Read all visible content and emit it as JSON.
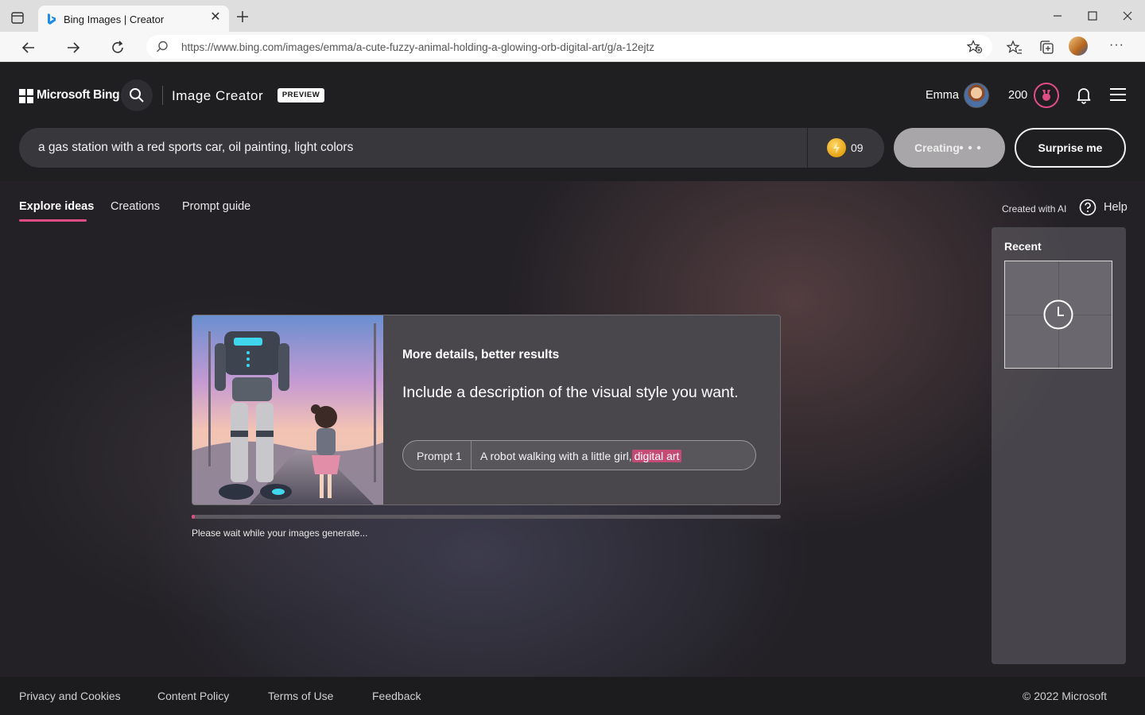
{
  "browser": {
    "tab_title": "Bing Images | Creator",
    "tab_close": "✕",
    "url": "https://www.bing.com/images/emma/a-cute-fuzzy-animal-holding-a-glowing-orb-digital-art/g/a-12ejtz",
    "more_label": "···"
  },
  "header": {
    "brand": "Microsoft Bing",
    "product": "Image Creator",
    "badge": "PREVIEW",
    "user_name": "Emma",
    "points": "200"
  },
  "prompt": {
    "value": "a gas station with a red sports car, oil painting, light colors",
    "boosts": "09"
  },
  "buttons": {
    "creating": "Creating",
    "surprise": "Surprise me"
  },
  "tabs": [
    {
      "label": "Explore ideas",
      "active": true
    },
    {
      "label": "Creations",
      "active": false
    },
    {
      "label": "Prompt guide",
      "active": false
    }
  ],
  "right_header": {
    "created_with_ai": "Created with AI",
    "help": "Help"
  },
  "recent": {
    "title": "Recent"
  },
  "tip": {
    "heading": "More details, better results",
    "body": "Include a description of the visual style you want.",
    "prompt_label": "Prompt 1",
    "prompt_text": "A robot walking with a little girl,",
    "prompt_highlight": "digital art"
  },
  "progress": {
    "fraction": 0.005,
    "message": "Please wait while your images generate..."
  },
  "footer": {
    "links": [
      "Privacy and Cookies",
      "Content Policy",
      "Terms of Use",
      "Feedback"
    ],
    "copyright": "© 2022 Microsoft"
  },
  "colors": {
    "accent": "#e04d86",
    "coin": "#f2b01e"
  }
}
